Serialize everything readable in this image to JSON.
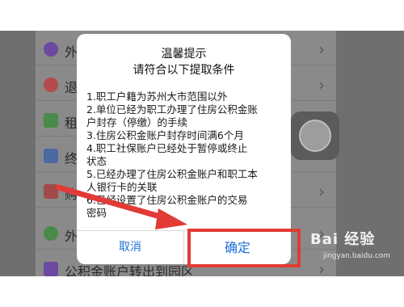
{
  "background_list": {
    "items": [
      {
        "label": "外",
        "icon": "purple-circle-icon",
        "color": "#6b4aa0"
      },
      {
        "label": "退",
        "icon": "red-circle-icon",
        "color": "#b44a4a"
      },
      {
        "label": "租",
        "icon": "green-square-icon",
        "color": "#4a8a4a"
      },
      {
        "label": "终",
        "icon": "blue-square-icon",
        "color": "#4a6aa0"
      },
      {
        "label": "购",
        "icon": "red-square-icon",
        "color": "#a04a4a"
      },
      {
        "label": "外",
        "icon": "green-circle-icon",
        "color": "#4a8a4a"
      },
      {
        "label": "公积金账户转出到园区",
        "icon": "purple-square-icon",
        "color": "#6b4aa0"
      }
    ],
    "chevron": "›"
  },
  "dialog": {
    "title_line1": "温馨提示",
    "title_line2": "请符合以下提取条件",
    "body_lines": [
      "1.职工户籍为苏州大市范围以外",
      "2.单位已经为职工办理了住房公积金账",
      "户封存（停缴）的手续",
      "3.住房公积金账户封存时间满6个月",
      "4.职工社保账户已经处于暂停或终止",
      "状态",
      "5.已经办理了住房公积金账户和职工本",
      "人银行卡的关联",
      "6.已经设置了住房公积金账户的交易",
      "密码"
    ],
    "cancel_label": "取消",
    "confirm_label": "确定"
  },
  "annotation": {
    "color": "#e23a35"
  },
  "watermark": {
    "brand": "Bai 经验",
    "url": "jingyan.baidu.com"
  }
}
